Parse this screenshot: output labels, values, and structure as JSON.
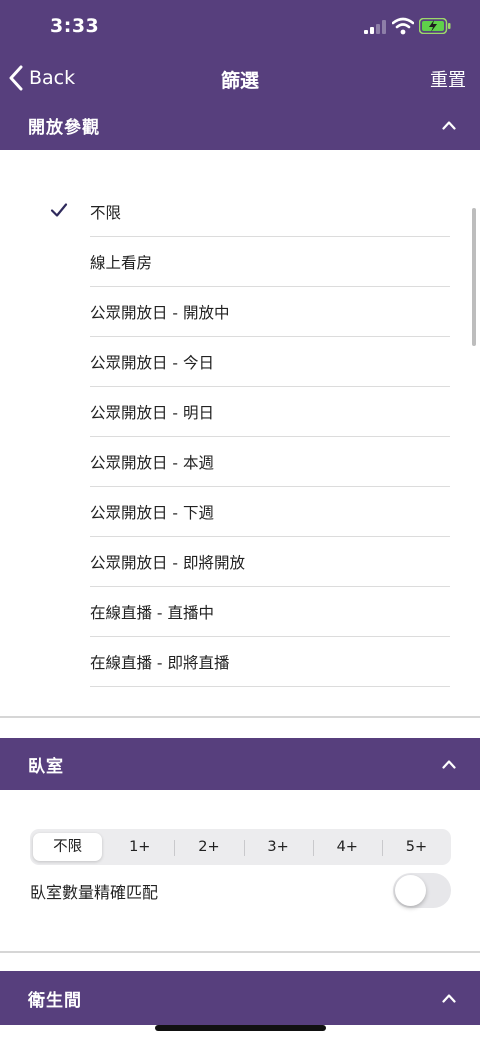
{
  "status_bar": {
    "time": "3:33"
  },
  "nav": {
    "back_label": "Back",
    "title": "篩選",
    "reset_label": "重置"
  },
  "open_house": {
    "header": "開放參觀",
    "selected_index": 0,
    "options": [
      "不限",
      "線上看房",
      "公眾開放日 - 開放中",
      "公眾開放日 - 今日",
      "公眾開放日 - 明日",
      "公眾開放日 - 本週",
      "公眾開放日 - 下週",
      "公眾開放日 - 即將開放",
      "在線直播 - 直播中",
      "在線直播 - 即將直播"
    ]
  },
  "bedroom": {
    "header": "臥室",
    "segments": [
      "不限",
      "1+",
      "2+",
      "3+",
      "4+",
      "5+"
    ],
    "selected_segment": "不限",
    "exact_match_label": "臥室數量精確匹配",
    "exact_match_on": false
  },
  "bathroom": {
    "header": "衛生間"
  },
  "colors": {
    "brand_purple": "#573f7d",
    "check_color": "#2f2a5c"
  },
  "icons": {
    "back": "chevron-left-icon",
    "collapse": "chevron-up-icon",
    "check": "checkmark-icon",
    "signal": "cellular-signal-icon",
    "wifi": "wifi-icon",
    "battery": "battery-charging-icon"
  }
}
